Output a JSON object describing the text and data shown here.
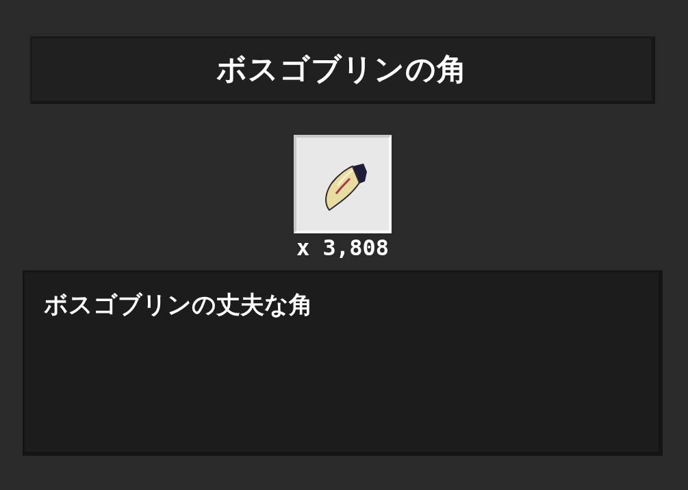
{
  "title": "ボスゴブリンの角",
  "item": {
    "kind": "picture",
    "count": "x 3,808"
  },
  "description": "ボスゴブリンの丈夫な角"
}
